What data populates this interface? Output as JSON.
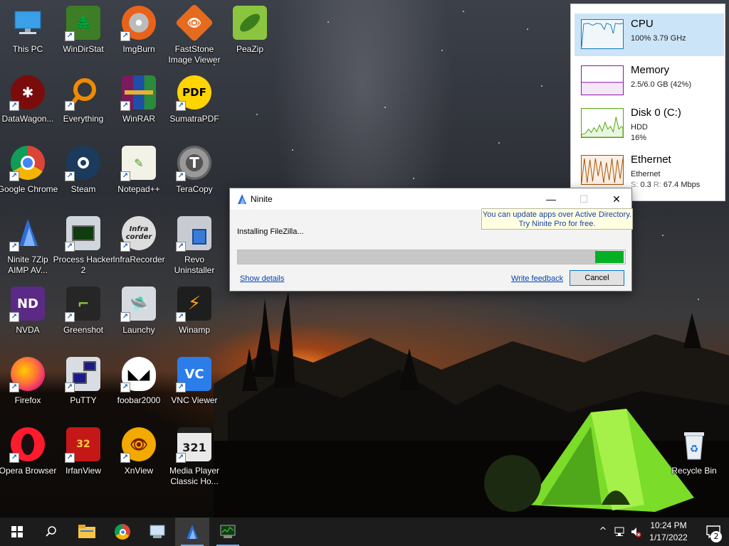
{
  "desktop": {
    "icons": [
      {
        "label": "This PC",
        "icon": "this-pc-icon"
      },
      {
        "label": "WinDirStat",
        "icon": "windirstat-icon"
      },
      {
        "label": "ImgBurn",
        "icon": "imgburn-icon"
      },
      {
        "label": "FastStone Image Viewer",
        "icon": "faststone-icon"
      },
      {
        "label": "PeaZip",
        "icon": "peazip-icon"
      },
      {
        "label": "DataWagon...",
        "icon": "datawagon-icon"
      },
      {
        "label": "Everything",
        "icon": "everything-icon"
      },
      {
        "label": "WinRAR",
        "icon": "winrar-icon"
      },
      {
        "label": "SumatraPDF",
        "icon": "sumatrapdf-icon"
      },
      {
        "label": "Google Chrome",
        "icon": "chrome-icon"
      },
      {
        "label": "Steam",
        "icon": "steam-icon"
      },
      {
        "label": "Notepad++",
        "icon": "notepadpp-icon"
      },
      {
        "label": "TeraCopy",
        "icon": "teracopy-icon"
      },
      {
        "label": "Ninite 7Zip AIMP AV...",
        "icon": "ninite-icon"
      },
      {
        "label": "Process Hacker 2",
        "icon": "process-hacker-icon"
      },
      {
        "label": "InfraRecorder",
        "icon": "infrarecorder-icon"
      },
      {
        "label": "Revo Uninstaller",
        "icon": "revo-icon"
      },
      {
        "label": "NVDA",
        "icon": "nvda-icon"
      },
      {
        "label": "Greenshot",
        "icon": "greenshot-icon"
      },
      {
        "label": "Launchy",
        "icon": "launchy-icon"
      },
      {
        "label": "Winamp",
        "icon": "winamp-icon"
      },
      {
        "label": "Firefox",
        "icon": "firefox-icon"
      },
      {
        "label": "PuTTY",
        "icon": "putty-icon"
      },
      {
        "label": "foobar2000",
        "icon": "foobar-icon"
      },
      {
        "label": "VNC Viewer",
        "icon": "vnc-icon"
      },
      {
        "label": "Opera Browser",
        "icon": "opera-icon"
      },
      {
        "label": "IrfanView",
        "icon": "irfanview-icon"
      },
      {
        "label": "XnView",
        "icon": "xnview-icon"
      },
      {
        "label": "Media Player Classic Ho...",
        "icon": "mpc-icon"
      },
      {
        "label": "Recycle Bin",
        "icon": "recycle-bin-icon"
      }
    ],
    "icon_glyphs": {
      "sumatra": "PDF",
      "teracopy": "T",
      "irfan": "32",
      "mpc": "321",
      "vnc": "VC",
      "nvda": "ND",
      "infrarecorder": "Infra corder"
    }
  },
  "perf_widget": {
    "cpu": {
      "title": "CPU",
      "detail": "100% 3.79 GHz",
      "color": "#117dbb"
    },
    "memory": {
      "title": "Memory",
      "detail": "2.5/6.0 GB (42%)",
      "color": "#8b12ae"
    },
    "disk": {
      "title": "Disk 0 (C:)",
      "type": "HDD",
      "detail": "16%",
      "color": "#4da60c"
    },
    "ethernet": {
      "title": "Ethernet",
      "name": "Ethernet",
      "send_label": "S:",
      "send": "0.3",
      "recv_label": "R:",
      "recv": "67.4 Mbps",
      "color": "#a74f01"
    }
  },
  "ninite": {
    "title": "Ninite",
    "promo_line1": "You can update apps over Active Directory.",
    "promo_line2": "Try Ninite Pro for free.",
    "status": "Installing FileZilla...",
    "show_details": "Show details",
    "write_feedback": "Write feedback",
    "cancel": "Cancel",
    "minimize_glyph": "—",
    "maximize_glyph": "☐",
    "close_glyph": "✕"
  },
  "taskbar": {
    "start_icon": "windows-logo-icon",
    "search_icon": "search-icon",
    "pinned": [
      "file-explorer-icon",
      "chrome-icon",
      "control-panel-icon",
      "ninite-icon",
      "process-hacker-icon"
    ],
    "tray": {
      "chevron_glyph": "^",
      "time": "10:24 PM",
      "date": "1/17/2022",
      "notification_count": "2"
    }
  }
}
